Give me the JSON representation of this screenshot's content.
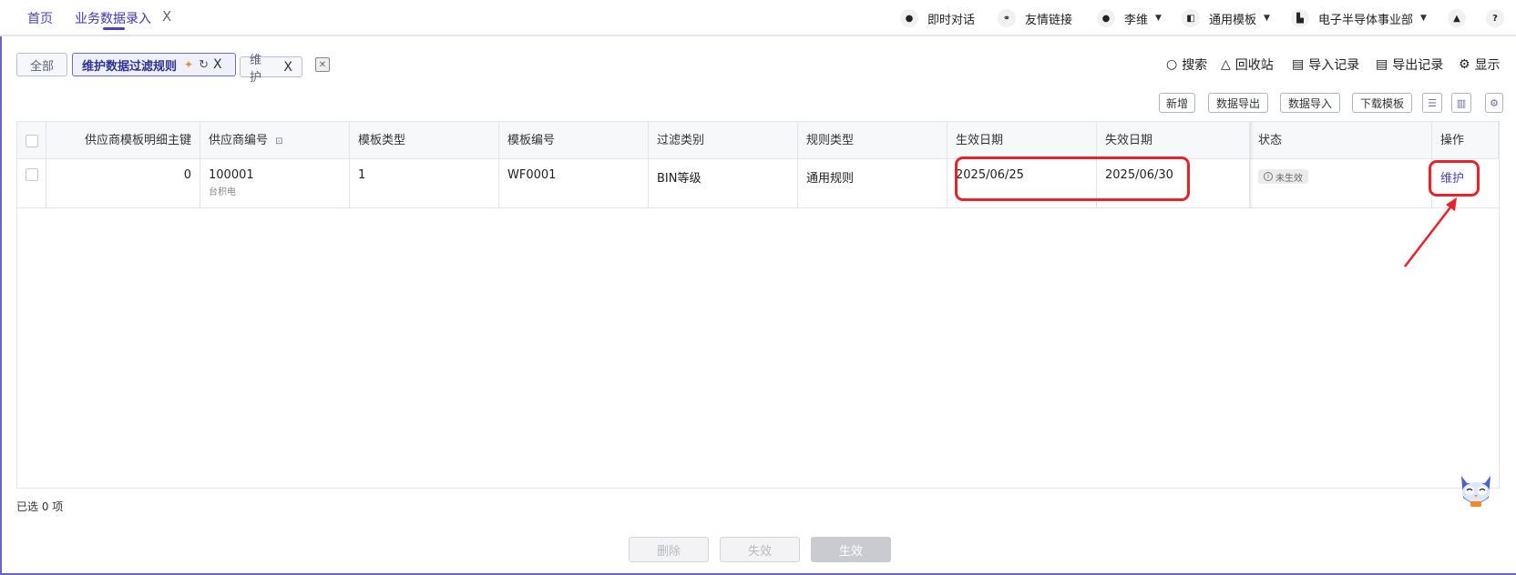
{
  "topnav": {
    "home": "首页",
    "current_tab": "业务数据录入",
    "close": "X",
    "chat": "即时对话",
    "links": "友情链接",
    "user": "李维",
    "template": "通用模板",
    "division": "电子半导体事业部"
  },
  "subtabs": {
    "all": "全部",
    "rules": "维护数据过滤规则",
    "maintain": "维护",
    "close": "X"
  },
  "toolbar": {
    "search": "搜索",
    "recycle": "回收站",
    "import_log": "导入记录",
    "export_log": "导出记录",
    "display": "显示",
    "add": "新增",
    "export": "数据导出",
    "import": "数据导入",
    "download": "下载模板"
  },
  "table": {
    "headers": [
      "供应商模板明细主键",
      "供应商编号",
      "模板类型",
      "模板编号",
      "过滤类别",
      "规则类型",
      "生效日期",
      "失效日期",
      "状态",
      "操作"
    ],
    "rows": [
      {
        "id": "0",
        "supplier_code": "100001",
        "supplier_name": "台积电",
        "template_type": "1",
        "template_code": "WF0001",
        "filter_category": "BIN等级",
        "rule_type": "通用规则",
        "effective_date": "2025/06/25",
        "expiry_date": "2025/06/30",
        "status": "未生效",
        "action": "维护"
      }
    ]
  },
  "footer": {
    "selected": "已选 0 项",
    "delete": "删除",
    "invalidate": "失效",
    "activate": "生效"
  },
  "colors": {
    "accent": "#4b45b8",
    "highlight": "#e8222b",
    "pin": "#f08a24"
  }
}
